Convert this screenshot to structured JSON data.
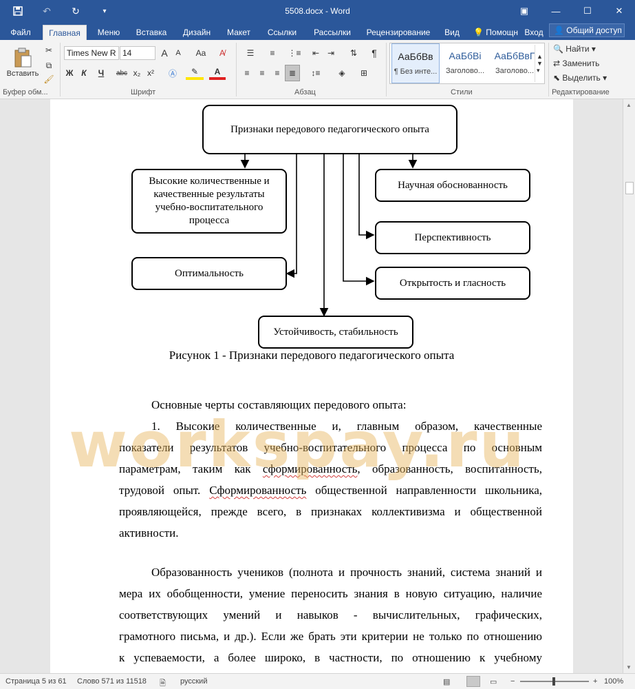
{
  "titlebar": {
    "title": "5508.docx - Word",
    "qat": {
      "save_icon": "save-icon",
      "undo_icon": "undo-icon",
      "redo_icon": "redo-icon",
      "customize_icon": "chevron-down-icon"
    },
    "window_controls": {
      "ribbon_display": "ribbon-display-icon",
      "minimize": "minimize-icon",
      "maximize": "maximize-icon",
      "close": "close-icon"
    }
  },
  "tabs": {
    "file": "Файл",
    "home": "Главная",
    "menu": "Меню",
    "insert": "Вставка",
    "design": "Дизайн",
    "layout": "Макет",
    "references": "Ссылки",
    "mailings": "Рассылки",
    "review": "Рецензирование",
    "view": "Вид",
    "help": "Помощн",
    "signin": "Вход",
    "share": "Общий доступ"
  },
  "ribbon": {
    "clipboard": {
      "paste_label": "Вставить",
      "group_label": "Буфер обм..."
    },
    "font": {
      "family": "Times New R",
      "size": "14",
      "group_label": "Шрифт",
      "bold": "Ж",
      "italic": "К",
      "underline": "Ч",
      "strike": "abc",
      "subscript": "x₂",
      "superscript": "x²",
      "grow": "A",
      "shrink": "A",
      "case": "Aa"
    },
    "paragraph": {
      "group_label": "Абзац",
      "pilcrow": "¶"
    },
    "styles": {
      "group_label": "Стили",
      "items": [
        {
          "sample": "АаБбВв",
          "name": "¶ Без инте..."
        },
        {
          "sample": "АаБбВі",
          "name": "Заголово..."
        },
        {
          "sample": "АаБбВвГ",
          "name": "Заголово..."
        }
      ]
    },
    "editing": {
      "group_label": "Редактирование",
      "find": "Найти",
      "replace": "Заменить",
      "select": "Выделить"
    }
  },
  "document": {
    "diagram": {
      "top": "Признаки передового педагогического опыта",
      "left1": "Высокие количественные и качественные результаты учебно-воспитательного процесса",
      "left2": "Оптимальность",
      "right1": "Научная обоснованность",
      "right2": "Перспективность",
      "right3": "Открытость и гласность",
      "bottom": "Устойчивость, стабильность"
    },
    "caption": "Рисунок 1 - Признаки передового педагогического опыта",
    "watermark": "workspay.ru",
    "p1": {
      "l1": "Основные черты составляющих передового опыта:",
      "l2": "1. Высокие количественные и, главным образом, качественные",
      "l3": "показатели результатов учебно-воспитательного процесса по основным",
      "l4a": "параметрам, таким как ",
      "l4b": "сформированность",
      "l4c": ", образованность, воспитанность,",
      "l5a": "трудовой опыт. ",
      "l5b": "Сформированность",
      "l5c": " общественной направленности школьника,",
      "l6": "проявляющейся, прежде всего, в признаках коллективизма и общественной",
      "l7": "активности."
    },
    "p2": {
      "l1": "Образованность учеников (полнота и прочность знаний, система знаний и",
      "l2": "мера их обобщенности, умение переносить знания в новую ситуацию, наличие",
      "l3": "соответствующих умений и навыков - вычислительных, графических,",
      "l4": "грамотного письма, и др.). Если же брать эти критерии не только по отношению",
      "l5": "к успеваемости, а более широко, в частности, по отношению к учебному"
    }
  },
  "statusbar": {
    "page": "Страница 5 из 61",
    "words": "Слово 571 из 11518",
    "language": "русский",
    "zoom": "100%"
  }
}
